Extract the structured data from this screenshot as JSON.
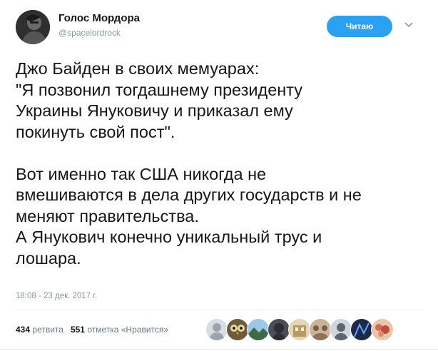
{
  "author": {
    "name": "Голос Мордора",
    "handle": "@spacelordrock"
  },
  "follow_button": {
    "label": "Читаю"
  },
  "tweet": {
    "text": "Джо Байден в своих мемуарах:\n\"Я позвонил тогдашнему президенту\nУкраины Януковичу и приказал ему\nпокинуть свой пост\".\n\nВот именно так США никогда не\nвмешиваются в дела других государств и не\nменяют правительства.\nА Янукович конечно уникальный трус и\nлошара.",
    "timestamp": "18:08 - 23 дек. 2017 г."
  },
  "stats": {
    "retweets_count": "434",
    "retweets_label": "ретвита",
    "likes_count": "551",
    "likes_label": "отметка «Нравится»"
  },
  "colors": {
    "accent": "#2aa1f2",
    "muted_text": "#8a98a5",
    "divider": "#e6ecf0"
  },
  "likers": [
    {
      "icon": "avatar-gray"
    },
    {
      "icon": "avatar-owl"
    },
    {
      "icon": "avatar-landscape"
    },
    {
      "icon": "avatar-dark"
    },
    {
      "icon": "avatar-building"
    },
    {
      "icon": "avatar-group"
    },
    {
      "icon": "avatar-portrait"
    },
    {
      "icon": "avatar-blue"
    },
    {
      "icon": "avatar-flowers"
    }
  ]
}
